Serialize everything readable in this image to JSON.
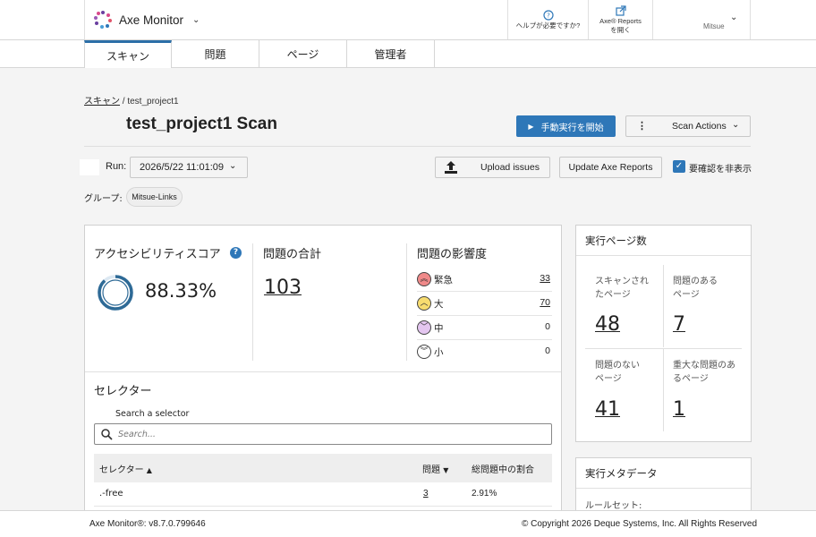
{
  "header": {
    "app_name": "Axe Monitor",
    "help_label": "ヘルプが必要ですか?",
    "reports_line1": "Axe® Reports",
    "reports_line2": "を開く",
    "user_name": "Mitsue"
  },
  "tabs": [
    {
      "label": "スキャン",
      "active": true
    },
    {
      "label": "問題",
      "active": false
    },
    {
      "label": "ページ",
      "active": false
    },
    {
      "label": "管理者",
      "active": false
    }
  ],
  "breadcrumb": {
    "link": "スキャン",
    "separator": " / ",
    "current": "test_project1"
  },
  "page": {
    "title": "test_project1 Scan",
    "run_manual_label": "手動実行を開始",
    "scan_actions_label": "Scan Actions"
  },
  "run": {
    "label": "Run:",
    "selected": "2026/5/22 11:01:09",
    "upload_label": "Upload issues",
    "update_label": "Update Axe Reports",
    "hide_review_label": "要確認を非表示",
    "hide_review_checked": true
  },
  "group": {
    "label": "グループ:",
    "chip": "Mitsue-Links"
  },
  "score": {
    "title": "アクセシビリティスコア",
    "help": "?",
    "value": "88.33%",
    "percent": 88.33
  },
  "total": {
    "title": "問題の合計",
    "value": "103"
  },
  "impact": {
    "title": "問題の影響度",
    "rows": [
      {
        "name": "緊急",
        "count": "33",
        "icon": "double-chevron-up-icon",
        "symbol": "︽",
        "color": "#f08a8a",
        "linked": true
      },
      {
        "name": "大",
        "count": "70",
        "icon": "chevron-up-icon",
        "symbol": "︿",
        "color": "#f7dc6f",
        "linked": true
      },
      {
        "name": "中",
        "count": "0",
        "icon": "chevron-down-icon",
        "symbol": "﹀",
        "color": "#e4c6f0",
        "linked": false
      },
      {
        "name": "小",
        "count": "0",
        "icon": "double-chevron-down-icon",
        "symbol": "︾",
        "color": "#ffffff",
        "linked": false
      }
    ]
  },
  "selectors": {
    "title": "セレクター",
    "search_label": "Search a selector",
    "search_placeholder": "Search...",
    "columns": [
      "セレクター",
      "問題",
      "総問題中の割合"
    ],
    "rows": [
      {
        "selector": ".-free",
        "issues": "3",
        "ratio": "2.91%"
      }
    ]
  },
  "pages_card": {
    "title": "実行ページ数",
    "stats": [
      {
        "label": "スキャンされたページ",
        "value": "48"
      },
      {
        "label": "問題のあるページ",
        "value": "7"
      },
      {
        "label": "問題のないページ",
        "value": "41"
      },
      {
        "label": "重大な問題のあるページ",
        "value": "1"
      }
    ]
  },
  "meta_card": {
    "title": "実行メタデータ",
    "ruleset_label": "ルールセット:"
  },
  "footer": {
    "version": "Axe Monitor®: v8.7.0.799646",
    "copyright": "© Copyright 2026 Deque Systems, Inc. All Rights Reserved"
  },
  "colors": {
    "accent": "#2e77b8",
    "tab_active": "#2c6fa8",
    "ring": "#2e6a96"
  }
}
